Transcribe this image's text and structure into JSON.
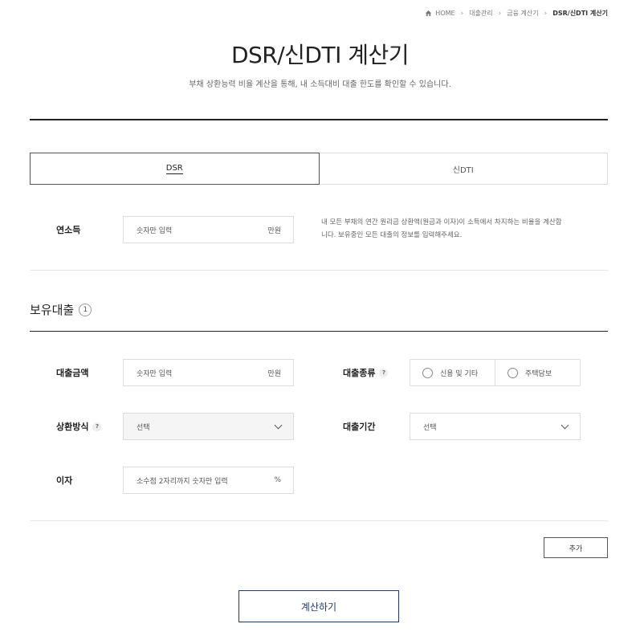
{
  "breadcrumb": {
    "home": "HOME",
    "items": [
      "대출관리",
      "금융 계산기",
      "DSR/신DTI 계산기"
    ]
  },
  "page": {
    "title": "DSR/신DTI 계산기",
    "subtitle": "부채 상환능력 비율 계산을 통해, 내 소득대비 대출 한도를 확인할 수 있습니다."
  },
  "tabs": [
    {
      "label": "DSR",
      "active": true
    },
    {
      "label": "신DTI",
      "active": false
    }
  ],
  "income": {
    "label": "연소득",
    "placeholder": "숫자만 입력",
    "unit": "만원",
    "help": "내 모든 부채의 연간 원리금 상환액(원금과 이자)이 소득에서 차지하는 비율을 계산합니다. 보유중인 모든 대출의 정보를 입력해주세요."
  },
  "loans_section": {
    "title": "보유대출",
    "count": "1"
  },
  "loan_form": {
    "amount": {
      "label": "대출금액",
      "placeholder": "숫자만 입력",
      "unit": "만원"
    },
    "type": {
      "label": "대출종류",
      "help_icon": "?",
      "options": [
        "신용 및 기타",
        "주택담보"
      ]
    },
    "repayment": {
      "label": "상환방식",
      "help_icon": "?",
      "value": "선택"
    },
    "period": {
      "label": "대출기간",
      "value": "선택"
    },
    "interest": {
      "label": "이자",
      "placeholder": "소수점 2자리까지 숫자만 입력",
      "unit": "%"
    }
  },
  "buttons": {
    "add": "추가",
    "calculate": "계산하기"
  },
  "colors": {
    "primary": "#1f3a66",
    "rule": "#222222",
    "border": "#dcdcdc"
  }
}
